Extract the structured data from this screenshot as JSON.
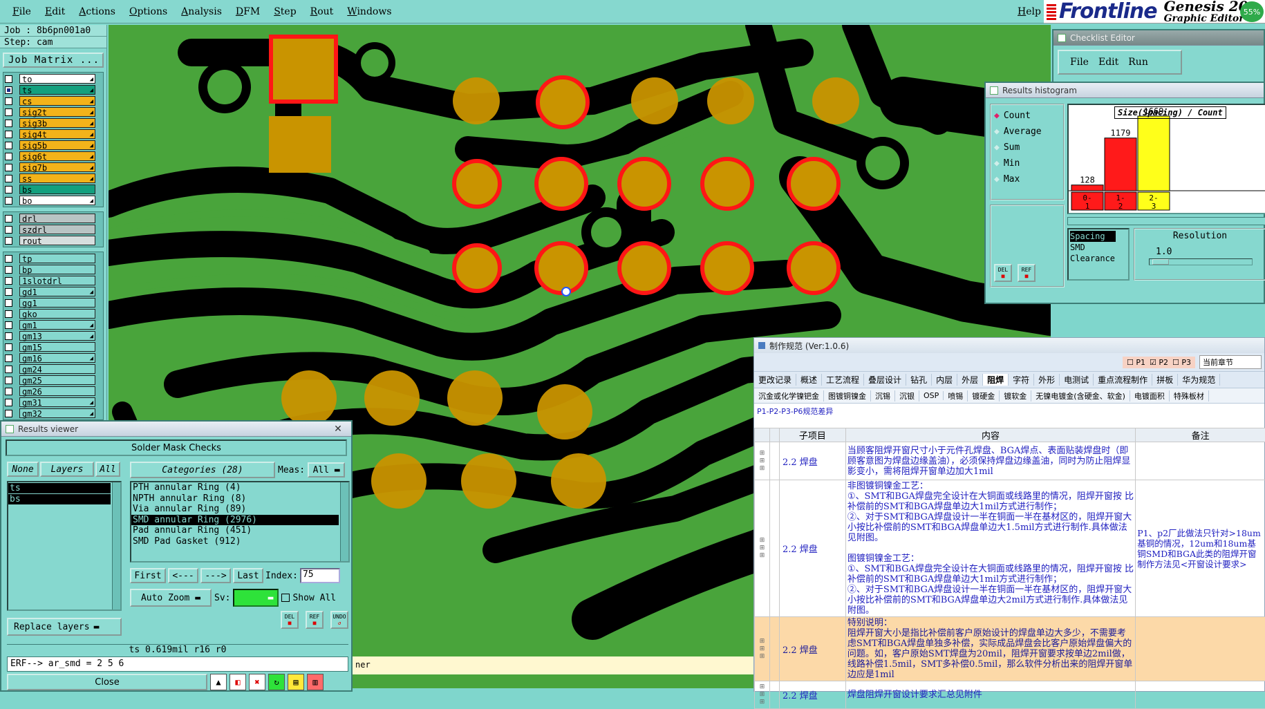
{
  "menubar": {
    "items": [
      "File",
      "Edit",
      "Actions",
      "Options",
      "Analysis",
      "DFM",
      "Step",
      "Rout",
      "Windows"
    ],
    "help": "Help"
  },
  "brand": {
    "logo": "Frontline",
    "product": "Genesis 20",
    "subtitle": "Graphic Editor",
    "badge": "55%"
  },
  "job": {
    "job_line": "Job : 8b6pn001a0",
    "step_line": "Step: cam",
    "matrix_button": "Job Matrix ..."
  },
  "layers": {
    "group1": [
      {
        "name": "to",
        "color": "#ffffff",
        "arrow": true
      },
      {
        "name": "ts",
        "color": "#13a07e",
        "arrow": true,
        "selected": true
      },
      {
        "name": "cs",
        "color": "#f3b31a",
        "arrow": true
      },
      {
        "name": "sig2t",
        "color": "#f3b31a",
        "arrow": true
      },
      {
        "name": "sig3b",
        "color": "#f3b31a",
        "arrow": true
      },
      {
        "name": "sig4t",
        "color": "#f3b31a",
        "arrow": true
      },
      {
        "name": "sig5b",
        "color": "#f3b31a",
        "arrow": true
      },
      {
        "name": "sig6t",
        "color": "#f3b31a",
        "arrow": true
      },
      {
        "name": "sig7b",
        "color": "#f3b31a",
        "arrow": true
      },
      {
        "name": "ss",
        "color": "#f3b31a",
        "arrow": true
      },
      {
        "name": "bs",
        "color": "#13a07e",
        "arrow": false
      },
      {
        "name": "bo",
        "color": "#ffffff",
        "arrow": true
      }
    ],
    "group2": [
      {
        "name": "drl",
        "color": "#b9c4c4",
        "arrow": false
      },
      {
        "name": "szdrl",
        "color": "#b9c4c4",
        "arrow": false
      },
      {
        "name": "rout",
        "color": "#d6dede",
        "arrow": false
      }
    ],
    "group3": [
      {
        "name": "tp",
        "color": "#86d8cf",
        "arrow": false
      },
      {
        "name": "bp",
        "color": "#86d8cf",
        "arrow": false
      },
      {
        "name": "1slotdrl",
        "color": "#86d8cf",
        "arrow": false
      },
      {
        "name": "gd1",
        "color": "#86d8cf",
        "arrow": true
      },
      {
        "name": "gg1",
        "color": "#86d8cf",
        "arrow": false
      },
      {
        "name": "gko",
        "color": "#86d8cf",
        "arrow": false
      },
      {
        "name": "gm1",
        "color": "#86d8cf",
        "arrow": true
      },
      {
        "name": "gm13",
        "color": "#86d8cf",
        "arrow": true
      },
      {
        "name": "gm15",
        "color": "#86d8cf",
        "arrow": false
      },
      {
        "name": "gm16",
        "color": "#86d8cf",
        "arrow": true
      },
      {
        "name": "gm24",
        "color": "#86d8cf",
        "arrow": false
      },
      {
        "name": "gm25",
        "color": "#86d8cf",
        "arrow": false
      },
      {
        "name": "gm26",
        "color": "#86d8cf",
        "arrow": false
      },
      {
        "name": "gm31",
        "color": "#86d8cf",
        "arrow": true
      },
      {
        "name": "gm32",
        "color": "#86d8cf",
        "arrow": true
      }
    ]
  },
  "results_viewer": {
    "title": "Results viewer",
    "header": "Solder Mask Checks",
    "btn_none": "None",
    "btn_layers": "Layers",
    "btn_all": "All",
    "categories_label": "Categories (28)",
    "meas_label": "Meas:",
    "meas_value": "All",
    "layers": [
      "ts",
      "bs"
    ],
    "categories": [
      "PTH annular Ring (4)",
      "NPTH annular Ring (8)",
      "Via annular Ring (89)",
      "SMD annular Ring (2976)",
      "Pad annular Ring (451)",
      "SMD Pad Gasket (912)"
    ],
    "selected_category_index": 3,
    "nav": {
      "first": "First",
      "prev": "<---",
      "next": "--->",
      "last": "Last",
      "index_label": "Index:",
      "index_value": "75"
    },
    "auto_zoom": "Auto Zoom",
    "sv_label": "Sv:",
    "show_all": "Show All",
    "replace_layers": "Replace layers",
    "del": "DEL",
    "ref": "REF",
    "undo": "UNDO",
    "measure_line": "ts 0.619mil  r16  r0",
    "erf_line": "ERF--> ar_smd = 2 5 6",
    "close": "Close"
  },
  "checklist_editor": {
    "title": "Checklist Editor",
    "menu": [
      "File",
      "Edit",
      "Run"
    ]
  },
  "histogram": {
    "title": "Results histogram",
    "options": [
      "Count",
      "Average",
      "Sum",
      "Min",
      "Max"
    ],
    "selected_option": "Count",
    "chart_label": "Size(Spacing) / Count",
    "resolution_label": "Resolution",
    "resolution_value": "1.0",
    "type_list": [
      "Spacing",
      "SMD",
      "Clearance"
    ],
    "del": "DEL",
    "ref": "REF"
  },
  "chart_data": {
    "type": "bar",
    "title": "Size(Spacing) / Count",
    "categories": [
      "0-1",
      "1-2",
      "2-3"
    ],
    "values": [
      128,
      1179,
      1669
    ],
    "colors": [
      "#ff1a1a",
      "#ff1a1a",
      "#ffff1a"
    ]
  },
  "spec_window": {
    "title": "制作规范 (Ver:1.0.6)",
    "checks": [
      "P1",
      "P2",
      "P3"
    ],
    "scope": "当前章节",
    "tabs1": [
      "更改记录",
      "概述",
      "工艺流程",
      "叠层设计",
      "钻孔",
      "内层",
      "外层",
      "阻焊",
      "字符",
      "外形",
      "电测试",
      "重点流程制作",
      "拼板",
      "华为规范"
    ],
    "active_tab": "阻焊",
    "tabs2": [
      "沉金或化学镍钯金",
      "图镀铜镍金",
      "沉锡",
      "沉银",
      "OSP",
      "喷锡",
      "镀硬金",
      "镀软金",
      "无镍电镀金(含硬金、软金)",
      "电镀面积",
      "特殊板材"
    ],
    "diff_label": "P1-P2-P3-P6规范差异",
    "table_headers": [
      "子项目",
      "内容",
      "备注"
    ],
    "rows": [
      {
        "item": "2.2 焊盘",
        "content": "当顾客阻焊开窗尺寸小于元件孔焊盘、BGA焊点、表面贴装焊盘时（即顾客意图为焊盘边缘盖油），必须保持焊盘边缘盖油，同时为防止阻焊显影变小，需将阻焊开窗单边加大1mil",
        "note": "",
        "highlight": false
      },
      {
        "item": "2.2 焊盘",
        "content": "非图镀铜镍金工艺：\n①、SMT和BGA焊盘完全设计在大铜面或线路里的情况，阻焊开窗按 比补偿前的SMT和BGA焊盘单边大1mil方式进行制作；\n②、对于SMT和BGA焊盘设计一半在铜面一半在基材区的，阻焊开窗大小按比补偿前的SMT和BGA焊盘单边大1.5mil方式进行制作.具体做法见附图。\n\n图镀铜镍金工艺：\n①、SMT和BGA焊盘完全设计在大铜面或线路里的情况，阻焊开窗按 比补偿前的SMT和BGA焊盘单边大1mil方式进行制作；\n②、对于SMT和BGA焊盘设计一半在铜面一半在基材区的，阻焊开窗大小按比补偿前的SMT和BGA焊盘单边大2mil方式进行制作.具体做法见附图。",
        "note": "P1、p2厂此做法只针对>18um基铜的情况，12um和18um基铜SMD和BGA此类的阻焊开窗制作方法见<开窗设计要求>",
        "highlight": false
      },
      {
        "item": "2.2 焊盘",
        "content": "特别说明：\n阻焊开窗大小是指比补偿前客户原始设计的焊盘单边大多少，不需要考虑SMT和BGA焊盘单独多补偿，实际成品焊盘会比客户原始焊盘偏大的问题。如，客户原始SMT焊盘为20mil，阻焊开窗要求按单边2mil做，线路补偿1.5mil，SMT多补偿0.5mil，那么软件分析出来的阻焊开窗单边应是1mil",
        "note": "",
        "highlight": true
      },
      {
        "item": "2.2 焊盘",
        "content": "焊盘阻焊开窗设计要求汇总见附件",
        "note": "",
        "highlight": false
      }
    ]
  },
  "status_strip": {
    "text": "ner"
  }
}
